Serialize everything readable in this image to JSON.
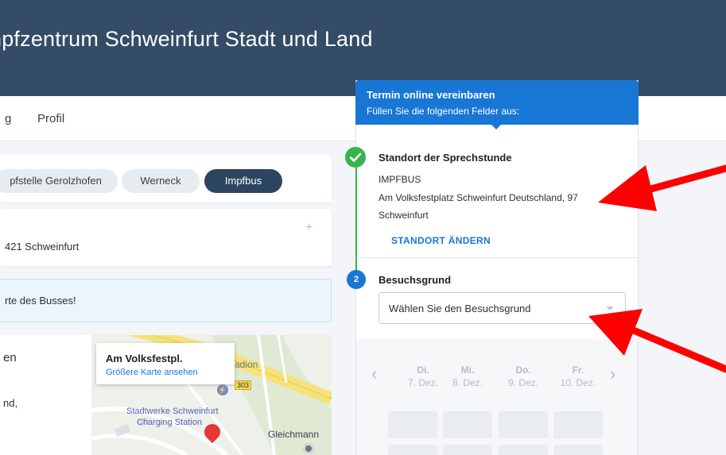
{
  "header": {
    "title": "npfzentrum Schweinfurt Stadt und Land"
  },
  "nav": {
    "items": [
      {
        "label": "g"
      },
      {
        "label": "Profil"
      }
    ]
  },
  "location_tabs": [
    {
      "label": "pfstelle Gerolzhofen",
      "active": false
    },
    {
      "label": "Werneck",
      "active": false
    },
    {
      "label": "Impfbus",
      "active": true
    }
  ],
  "address_card": {
    "plus": "+",
    "text": "421 Schweinfurt"
  },
  "info_box": {
    "text": "rte des Busses!"
  },
  "map_panel": {
    "left_texts": [
      "en",
      "nd,"
    ],
    "popup_title": "Am Volksfestpl.",
    "popup_link": "Größere Karte ansehen",
    "labels": {
      "stadion": "adion",
      "road_badge": "303",
      "station_line1": "Stadtwerke Schweinfurt",
      "station_line2": "Charging Station",
      "place": "Gleichmann"
    }
  },
  "booking": {
    "header_title": "Termin online vereinbaren",
    "header_subtitle": "Füllen Sie die folgenden Felder aus:",
    "step1": {
      "title": "Standort der Sprechstunde",
      "line1": "IMPFBUS",
      "line2": "Am Volksfestplatz Schweinfurt Deutschland, 97",
      "line3": "Schweinfurt",
      "change_button": "STANDORT ÄNDERN"
    },
    "step2": {
      "number": "2",
      "title": "Besuchsgrund",
      "select_value": "Wählen Sie den Besuchsgrund"
    },
    "calendar": {
      "prev_label": "‹",
      "next_label": "›",
      "days": [
        {
          "day": "Di.",
          "date": "7. Dez."
        },
        {
          "day": "Mi.",
          "date": "8. Dez."
        },
        {
          "day": "Do.",
          "date": "9. Dez."
        },
        {
          "day": "Fr.",
          "date": "10. Dez."
        }
      ]
    }
  },
  "colors": {
    "header_bg": "#344c66",
    "primary": "#1877d4",
    "success": "#37b24d",
    "annotation_arrow": "#ff0000"
  }
}
